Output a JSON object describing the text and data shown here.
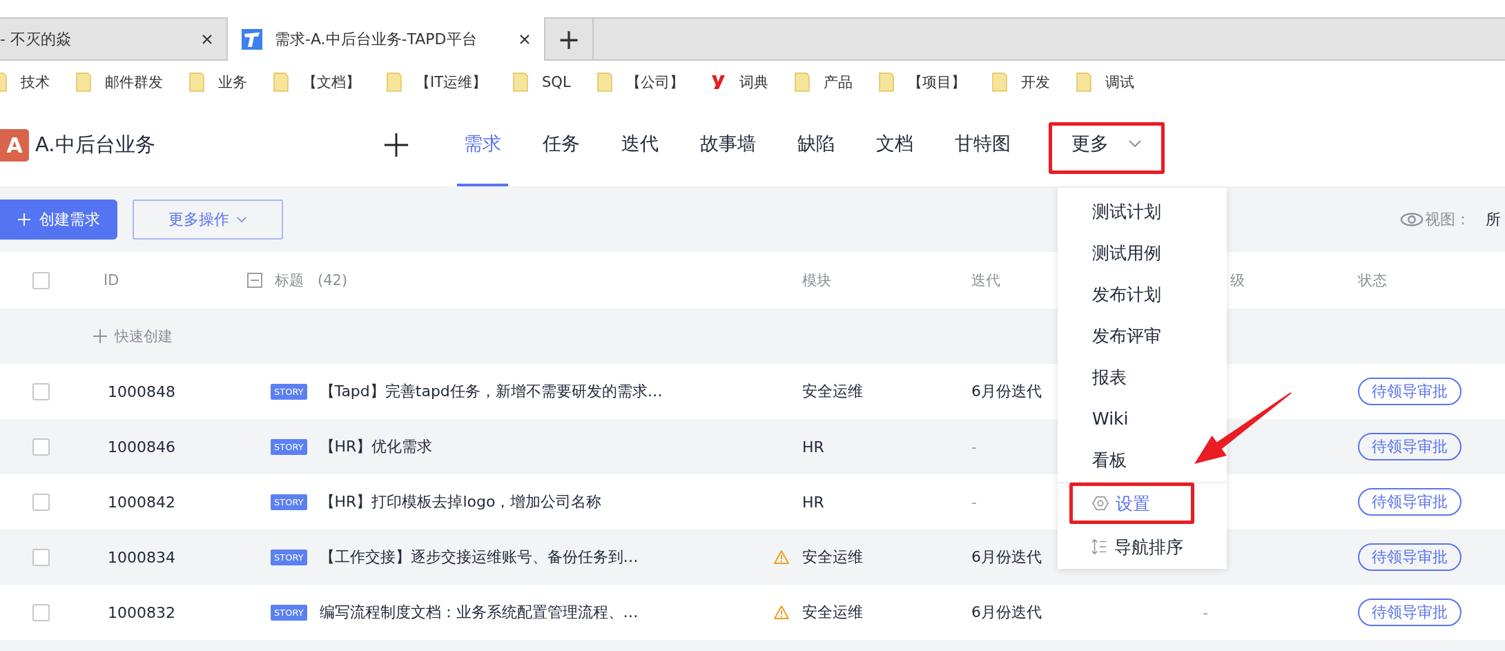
{
  "browser_tabs": [
    {
      "title": "- 不灭的焱",
      "selected": false,
      "kind": "plain"
    },
    {
      "title": "需求-A.中后台业务-TAPD平台",
      "selected": true,
      "kind": "tapd"
    }
  ],
  "new_tab": "+",
  "bookmarks": [
    {
      "label": "技术",
      "kind": "folder"
    },
    {
      "label": "邮件群发",
      "kind": "folder"
    },
    {
      "label": "业务",
      "kind": "folder"
    },
    {
      "label": "【文档】",
      "kind": "folder"
    },
    {
      "label": "【IT运维】",
      "kind": "folder"
    },
    {
      "label": "SQL",
      "kind": "folder"
    },
    {
      "label": "【公司】",
      "kind": "folder"
    },
    {
      "label": "词典",
      "kind": "dict"
    },
    {
      "label": "产品",
      "kind": "folder"
    },
    {
      "label": "【项目】",
      "kind": "folder"
    },
    {
      "label": "开发",
      "kind": "folder"
    },
    {
      "label": "调试",
      "kind": "folder"
    }
  ],
  "project": {
    "badge": "A",
    "name": "A.中后台业务"
  },
  "nav": [
    {
      "label": "需求",
      "selected": true
    },
    {
      "label": "任务",
      "selected": false
    },
    {
      "label": "迭代",
      "selected": false
    },
    {
      "label": "故事墙",
      "selected": false
    },
    {
      "label": "缺陷",
      "selected": false
    },
    {
      "label": "文档",
      "selected": false
    },
    {
      "label": "甘特图",
      "selected": false
    }
  ],
  "more": {
    "label": "更多",
    "expanded": true,
    "highlighted": true
  },
  "more_menu": {
    "items": [
      {
        "label": "测试计划",
        "selected": false
      },
      {
        "label": "测试用例",
        "selected": false
      },
      {
        "label": "发布计划",
        "selected": false
      },
      {
        "label": "发布评审",
        "selected": false
      },
      {
        "label": "报表",
        "selected": false
      },
      {
        "label": "Wiki",
        "selected": false
      },
      {
        "label": "看板",
        "selected": false
      }
    ],
    "footer_items": [
      {
        "label": "设置",
        "kind": "settings",
        "selected": true,
        "highlighted": true
      },
      {
        "label": "导航排序",
        "kind": "sort",
        "selected": false,
        "highlighted": false
      }
    ]
  },
  "toolbar": {
    "create_button": "创建需求",
    "more_actions": "更多操作",
    "view_label": "视图：",
    "view_value": "所"
  },
  "table": {
    "all_checked": false,
    "columns": [
      "ID",
      "标题",
      "模块",
      "迭代",
      "级",
      "状态"
    ],
    "title_count": "(42)",
    "quick_create": "快速创建",
    "rows": [
      {
        "checked": false,
        "id": "1000848",
        "type": "STORY",
        "title": "【Tapd】完善tapd任务，新增不需要研发的需求…",
        "warning": false,
        "module": "安全运维",
        "iteration": "6月份迭代",
        "status": "待领导审批"
      },
      {
        "checked": false,
        "id": "1000846",
        "type": "STORY",
        "title": "【HR】优化需求",
        "warning": false,
        "module": "HR",
        "iteration": "-",
        "status": "待领导审批"
      },
      {
        "checked": false,
        "id": "1000842",
        "type": "STORY",
        "title": "【HR】打印模板去掉logo，增加公司名称",
        "warning": false,
        "module": "HR",
        "iteration": "-",
        "status": "待领导审批"
      },
      {
        "checked": false,
        "id": "1000834",
        "type": "STORY",
        "title": "【工作交接】逐步交接运维账号、备份任务到…",
        "warning": true,
        "module": "安全运维",
        "iteration": "6月份迭代",
        "status": "待领导审批"
      },
      {
        "checked": false,
        "id": "1000832",
        "type": "STORY",
        "title": "编写流程制度文档：业务系统配置管理流程、…",
        "warning": true,
        "module": "安全运维",
        "iteration": "6月份迭代",
        "priority": "-",
        "status": "待领导审批"
      }
    ]
  }
}
